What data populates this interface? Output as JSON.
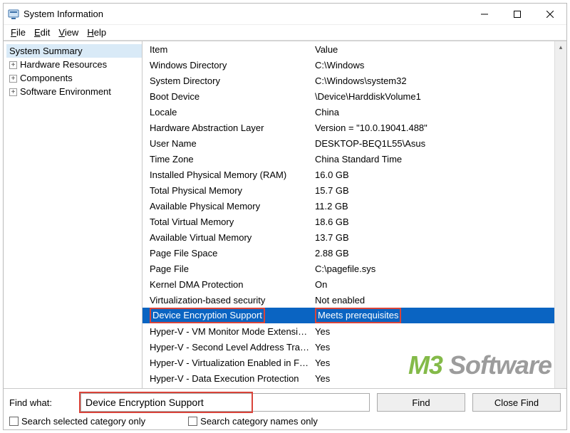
{
  "window": {
    "title": "System Information"
  },
  "menu": {
    "file": "File",
    "edit": "Edit",
    "view": "View",
    "help": "Help"
  },
  "tree": {
    "summary": "System Summary",
    "hardware": "Hardware Resources",
    "components": "Components",
    "software": "Software Environment"
  },
  "columns": {
    "item": "Item",
    "value": "Value"
  },
  "rows": [
    {
      "item": "Windows Directory",
      "value": "C:\\Windows"
    },
    {
      "item": "System Directory",
      "value": "C:\\Windows\\system32"
    },
    {
      "item": "Boot Device",
      "value": "\\Device\\HarddiskVolume1"
    },
    {
      "item": "Locale",
      "value": "China"
    },
    {
      "item": "Hardware Abstraction Layer",
      "value": "Version = \"10.0.19041.488\""
    },
    {
      "item": "User Name",
      "value": "DESKTOP-BEQ1L55\\Asus"
    },
    {
      "item": "Time Zone",
      "value": "China Standard Time"
    },
    {
      "item": "Installed Physical Memory (RAM)",
      "value": "16.0 GB"
    },
    {
      "item": "Total Physical Memory",
      "value": "15.7 GB"
    },
    {
      "item": "Available Physical Memory",
      "value": "11.2 GB"
    },
    {
      "item": "Total Virtual Memory",
      "value": "18.6 GB"
    },
    {
      "item": "Available Virtual Memory",
      "value": "13.7 GB"
    },
    {
      "item": "Page File Space",
      "value": "2.88 GB"
    },
    {
      "item": "Page File",
      "value": "C:\\pagefile.sys"
    },
    {
      "item": "Kernel DMA Protection",
      "value": "On"
    },
    {
      "item": "Virtualization-based security",
      "value": "Not enabled"
    },
    {
      "item": "Device Encryption Support",
      "value": "Meets prerequisites",
      "selected": true,
      "highlight": true
    },
    {
      "item": "Hyper-V - VM Monitor Mode Extensions",
      "value": "Yes"
    },
    {
      "item": "Hyper-V - Second Level Address Translatio…",
      "value": "Yes"
    },
    {
      "item": "Hyper-V - Virtualization Enabled in Firmw…",
      "value": "Yes"
    },
    {
      "item": "Hyper-V - Data Execution Protection",
      "value": "Yes"
    }
  ],
  "find": {
    "label": "Find what:",
    "value": "Device Encryption Support",
    "findBtn": "Find",
    "closeBtn": "Close Find",
    "chkSelected": "Search selected category only",
    "chkNames": "Search category names only"
  },
  "watermark": {
    "m3": "M3",
    "rest": " Software"
  }
}
